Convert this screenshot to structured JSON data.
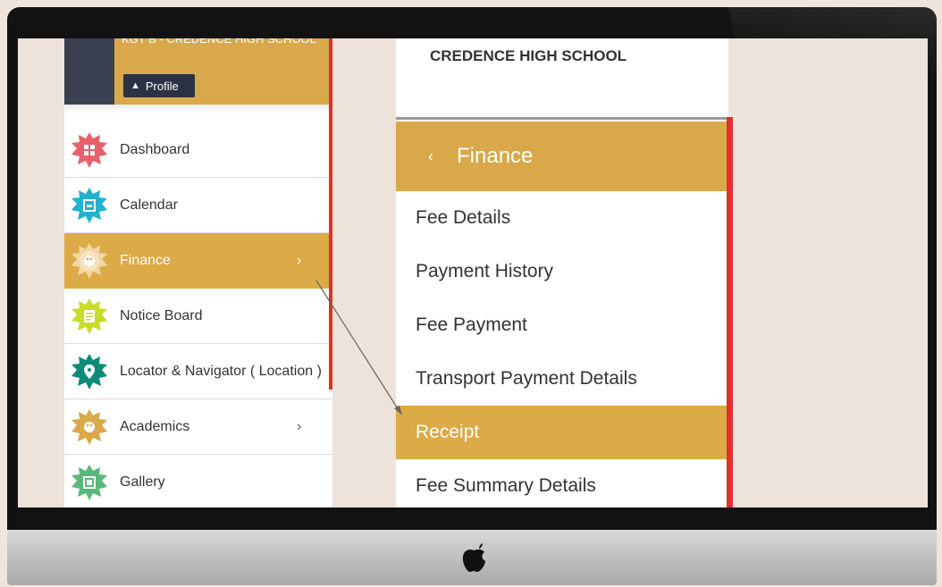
{
  "left_panel": {
    "school_name": "KGT B - CREDENCE HIGH SCHOOL",
    "profile_label": "Profile",
    "menu": [
      {
        "label": "Dashboard",
        "icon": "dashboard-icon",
        "color": "#e8616a",
        "chevron": ""
      },
      {
        "label": "Calendar",
        "icon": "calendar-icon",
        "color": "#1fb3cf",
        "chevron": ""
      },
      {
        "label": "Finance",
        "icon": "palette-icon",
        "color": "#f2d7a6",
        "chevron": "›"
      },
      {
        "label": "Notice Board",
        "icon": "notice-icon",
        "color": "#c8dc2a",
        "chevron": ""
      },
      {
        "label": "Locator & Navigator ( Location )",
        "icon": "location-pin-icon",
        "color": "#0e8a78",
        "chevron": ""
      },
      {
        "label": "Academics",
        "icon": "academics-icon",
        "color": "#d9a84a",
        "chevron": "›"
      },
      {
        "label": "Gallery",
        "icon": "gallery-icon",
        "color": "#5ab97a",
        "chevron": ""
      }
    ],
    "active_item": "Finance"
  },
  "right_panel": {
    "school_title": "CREDENCE HIGH SCHOOL",
    "section_title": "Finance",
    "back_glyph": "‹",
    "items": [
      {
        "label": "Fee Details"
      },
      {
        "label": "Payment History"
      },
      {
        "label": "Fee Payment"
      },
      {
        "label": "Transport Payment Details"
      },
      {
        "label": "Receipt"
      },
      {
        "label": "Fee Summary Details"
      }
    ],
    "active_item": "Receipt"
  },
  "colors": {
    "accent": "#d9a84a",
    "highlight_bar": "#e0302c",
    "header_dark": "#3b4050"
  }
}
